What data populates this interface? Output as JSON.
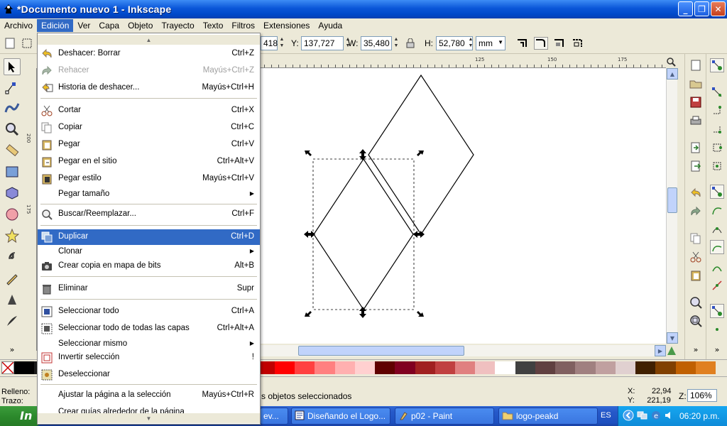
{
  "window": {
    "title": "*Documento nuevo 1 - Inkscape",
    "controls": [
      "_",
      "❐",
      "✕"
    ]
  },
  "menubar": {
    "items": [
      "Archivo",
      "Edición",
      "Ver",
      "Capa",
      "Objeto",
      "Trayecto",
      "Texto",
      "Filtros",
      "Extensiones",
      "Ayuda"
    ],
    "active": "Edición"
  },
  "toolbar": {
    "x_value": "418",
    "y_label": "Y:",
    "y_value": "137,727",
    "w_label": "W:",
    "w_value": "35,480",
    "h_label": "H:",
    "h_value": "52,780",
    "unit": "mm"
  },
  "ruler": {
    "h_labels": [
      "125",
      "150",
      "175"
    ],
    "v_labels": [
      "200",
      "175"
    ]
  },
  "edit_menu": {
    "items": [
      {
        "label": "Deshacer: Borrar",
        "accel": "Ctrl+Z",
        "icon": "undo-icon"
      },
      {
        "label": "Rehacer",
        "accel": "Mayús+Ctrl+Z",
        "icon": "redo-icon",
        "disabled": true
      },
      {
        "label": "Historia de deshacer...",
        "accel": "Mayús+Ctrl+H",
        "icon": "history-icon"
      },
      {
        "label": "Cortar",
        "accel": "Ctrl+X",
        "icon": "scissors-icon"
      },
      {
        "label": "Copiar",
        "accel": "Ctrl+C",
        "icon": "copy-icon"
      },
      {
        "label": "Pegar",
        "accel": "Ctrl+V",
        "icon": "paste-icon"
      },
      {
        "label": "Pegar en el sitio",
        "accel": "Ctrl+Alt+V",
        "icon": "paste-in-place-icon"
      },
      {
        "label": "Pegar estilo",
        "accel": "Mayús+Ctrl+V",
        "icon": "paste-style-icon"
      },
      {
        "label": "Pegar tamaño",
        "accel": "",
        "icon": "",
        "submenu": true
      },
      {
        "label": "Buscar/Reemplazar...",
        "accel": "Ctrl+F",
        "icon": "search-icon"
      },
      {
        "label": "Duplicar",
        "accel": "Ctrl+D",
        "icon": "duplicate-icon",
        "highlighted": true
      },
      {
        "label": "Clonar",
        "accel": "",
        "icon": "",
        "submenu": true
      },
      {
        "label": "Crear copia en mapa de bits",
        "accel": "Alt+B",
        "icon": "camera-icon"
      },
      {
        "label": "Eliminar",
        "accel": "Supr",
        "icon": "trash-icon"
      },
      {
        "label": "Seleccionar todo",
        "accel": "Ctrl+A",
        "icon": "select-all-icon"
      },
      {
        "label": "Seleccionar todo de todas las capas",
        "accel": "Ctrl+Alt+A",
        "icon": "select-all-layers-icon"
      },
      {
        "label": "Seleccionar mismo",
        "accel": "",
        "icon": "",
        "submenu": true
      },
      {
        "label": "Invertir selección",
        "accel": "!",
        "icon": "invert-selection-icon"
      },
      {
        "label": "Deseleccionar",
        "accel": "",
        "icon": "deselect-icon"
      },
      {
        "label": "Ajustar la página a la selección",
        "accel": "Mayús+Ctrl+R",
        "icon": ""
      },
      {
        "label": "Crear guías alrededor de la página",
        "accel": "",
        "icon": ""
      }
    ]
  },
  "status": {
    "fill_label": "Relleno:",
    "stroke_label": "Trazo:",
    "message": "s objetos seleccionados",
    "x_label": "X:",
    "x_value": "22,94",
    "y_label": "Y:",
    "y_value": "221,19",
    "zoom_label": "Z:",
    "zoom_value": "106%"
  },
  "taskbar": {
    "start_label": "In",
    "tasks": [
      "ev...",
      "Diseñando  el Logo...",
      "p02 - Paint",
      "logo-peakd"
    ],
    "language": "ES",
    "clock": "06:20 p.m."
  },
  "palette": [
    "#000000",
    "#1a1a1a",
    "#00ffff",
    "#00a0ff",
    "#0000ff",
    "#2000a0",
    "#8000a0",
    "#ff00ff",
    "#800040",
    "#400000",
    "#800000",
    "#a00000",
    "#c00000",
    "#ff0000",
    "#ff4040",
    "#ff8080",
    "#ffb0b0",
    "#ffd0d0",
    "#600000",
    "#800020",
    "#a02020",
    "#c04040",
    "#e08080",
    "#f0c0c0",
    "#ffffff",
    "#404040",
    "#604040",
    "#806060",
    "#a08080",
    "#c0a0a0",
    "#e0d0d0",
    "#402000",
    "#804000",
    "#c06000",
    "#e08020"
  ]
}
